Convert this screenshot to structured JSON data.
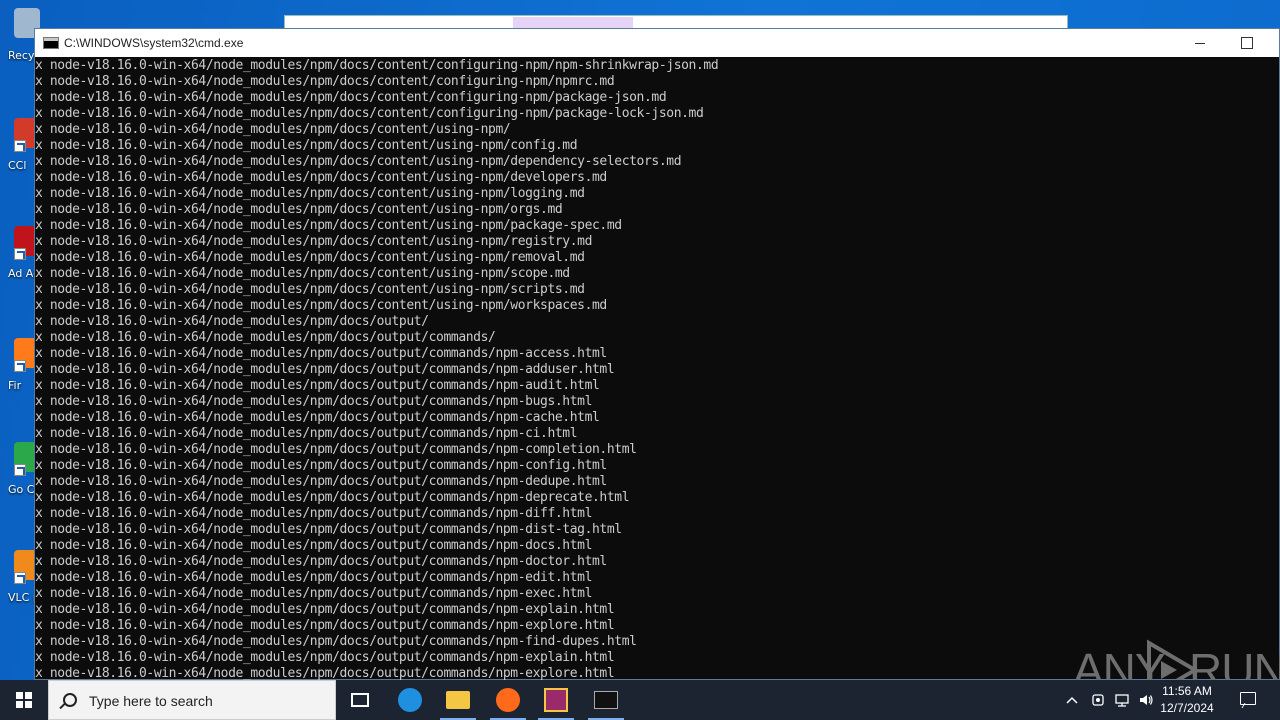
{
  "desktop": {
    "icons": [
      {
        "label": "Recy",
        "name": "desktop-icon-recycle-bin",
        "color": "#9fb8d0"
      },
      {
        "label": "CCl",
        "name": "desktop-icon-ccleaner",
        "color": "#d23a2a"
      },
      {
        "label": "Ad Acr",
        "name": "desktop-icon-adobe-acrobat",
        "color": "#c0141c"
      },
      {
        "label": "Fir",
        "name": "desktop-icon-firefox",
        "color": "#ff7a1a"
      },
      {
        "label": "Go Chr",
        "name": "desktop-icon-google-chrome",
        "color": "#2aa84a"
      },
      {
        "label": "VLC pl",
        "name": "desktop-icon-vlc",
        "color": "#f08a1c"
      }
    ]
  },
  "cmd_window": {
    "title": "C:\\WINDOWS\\system32\\cmd.exe",
    "lines": [
      "x node-v18.16.0-win-x64/node_modules/npm/docs/content/configuring-npm/npm-shrinkwrap-json.md",
      "x node-v18.16.0-win-x64/node_modules/npm/docs/content/configuring-npm/npmrc.md",
      "x node-v18.16.0-win-x64/node_modules/npm/docs/content/configuring-npm/package-json.md",
      "x node-v18.16.0-win-x64/node_modules/npm/docs/content/configuring-npm/package-lock-json.md",
      "x node-v18.16.0-win-x64/node_modules/npm/docs/content/using-npm/",
      "x node-v18.16.0-win-x64/node_modules/npm/docs/content/using-npm/config.md",
      "x node-v18.16.0-win-x64/node_modules/npm/docs/content/using-npm/dependency-selectors.md",
      "x node-v18.16.0-win-x64/node_modules/npm/docs/content/using-npm/developers.md",
      "x node-v18.16.0-win-x64/node_modules/npm/docs/content/using-npm/logging.md",
      "x node-v18.16.0-win-x64/node_modules/npm/docs/content/using-npm/orgs.md",
      "x node-v18.16.0-win-x64/node_modules/npm/docs/content/using-npm/package-spec.md",
      "x node-v18.16.0-win-x64/node_modules/npm/docs/content/using-npm/registry.md",
      "x node-v18.16.0-win-x64/node_modules/npm/docs/content/using-npm/removal.md",
      "x node-v18.16.0-win-x64/node_modules/npm/docs/content/using-npm/scope.md",
      "x node-v18.16.0-win-x64/node_modules/npm/docs/content/using-npm/scripts.md",
      "x node-v18.16.0-win-x64/node_modules/npm/docs/content/using-npm/workspaces.md",
      "x node-v18.16.0-win-x64/node_modules/npm/docs/output/",
      "x node-v18.16.0-win-x64/node_modules/npm/docs/output/commands/",
      "x node-v18.16.0-win-x64/node_modules/npm/docs/output/commands/npm-access.html",
      "x node-v18.16.0-win-x64/node_modules/npm/docs/output/commands/npm-adduser.html",
      "x node-v18.16.0-win-x64/node_modules/npm/docs/output/commands/npm-audit.html",
      "x node-v18.16.0-win-x64/node_modules/npm/docs/output/commands/npm-bugs.html",
      "x node-v18.16.0-win-x64/node_modules/npm/docs/output/commands/npm-cache.html",
      "x node-v18.16.0-win-x64/node_modules/npm/docs/output/commands/npm-ci.html",
      "x node-v18.16.0-win-x64/node_modules/npm/docs/output/commands/npm-completion.html",
      "x node-v18.16.0-win-x64/node_modules/npm/docs/output/commands/npm-config.html",
      "x node-v18.16.0-win-x64/node_modules/npm/docs/output/commands/npm-dedupe.html",
      "x node-v18.16.0-win-x64/node_modules/npm/docs/output/commands/npm-deprecate.html",
      "x node-v18.16.0-win-x64/node_modules/npm/docs/output/commands/npm-diff.html",
      "x node-v18.16.0-win-x64/node_modules/npm/docs/output/commands/npm-dist-tag.html",
      "x node-v18.16.0-win-x64/node_modules/npm/docs/output/commands/npm-docs.html",
      "x node-v18.16.0-win-x64/node_modules/npm/docs/output/commands/npm-doctor.html",
      "x node-v18.16.0-win-x64/node_modules/npm/docs/output/commands/npm-edit.html",
      "x node-v18.16.0-win-x64/node_modules/npm/docs/output/commands/npm-exec.html",
      "x node-v18.16.0-win-x64/node_modules/npm/docs/output/commands/npm-explain.html",
      "x node-v18.16.0-win-x64/node_modules/npm/docs/output/commands/npm-explore.html",
      "x node-v18.16.0-win-x64/node_modules/npm/docs/output/commands/npm-find-dupes.html",
      "x node-v18.16.0-win-x64/node_modules/npm/docs/output/commands/npm-explain.html",
      "x node-v18.16.0-win-x64/node_modules/npm/docs/output/commands/npm-explore.html"
    ]
  },
  "watermark": {
    "left": "ANY",
    "right": "RUN"
  },
  "taskbar": {
    "search_placeholder": "Type here to search",
    "apps": [
      {
        "name": "taskbar-task-view",
        "color": "#ffffff"
      },
      {
        "name": "taskbar-edge",
        "color": "#1f8fe0"
      },
      {
        "name": "taskbar-file-explorer",
        "color": "#f3c744"
      },
      {
        "name": "taskbar-firefox",
        "color": "#ff6a1a"
      },
      {
        "name": "taskbar-winrar",
        "color": "#9a2a6a"
      },
      {
        "name": "taskbar-cmd",
        "color": "#111111"
      }
    ],
    "clock_time": "11:56 AM",
    "clock_date": "12/7/2024"
  }
}
